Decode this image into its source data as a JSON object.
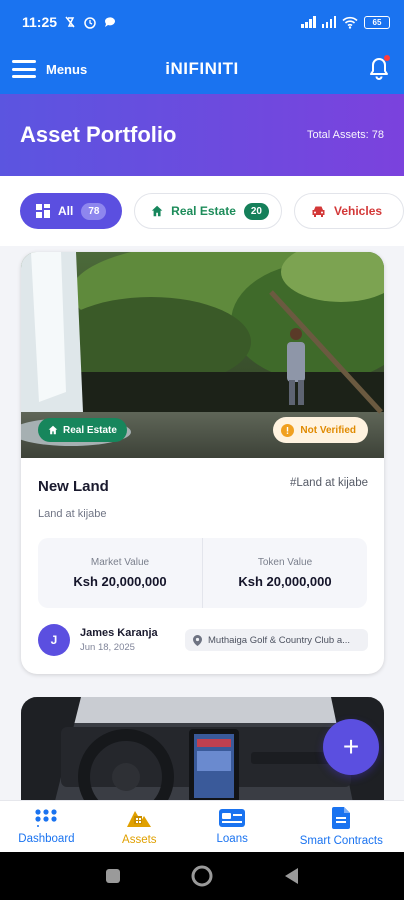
{
  "status_bar": {
    "time": "11:25",
    "battery": "65"
  },
  "app_bar": {
    "menu_label": "Menus",
    "title": "iNIFINITI"
  },
  "header": {
    "title": "Asset Portfolio",
    "total_assets": "Total Assets: 78"
  },
  "filters": [
    {
      "label": "All",
      "count": "78",
      "icon": "grid-icon",
      "selected": true
    },
    {
      "label": "Real Estate",
      "count": "20",
      "icon": "house-icon",
      "color": "#17865c"
    },
    {
      "label": "Vehicles",
      "icon": "car-icon",
      "color": "#d33838"
    }
  ],
  "asset_card": {
    "category": "Real Estate",
    "verification": "Not Verified",
    "title": "New Land",
    "code": "#Land at kijabe",
    "description": "Land at kijabe",
    "market_value_label": "Market Value",
    "market_value": "Ksh 20,000,000",
    "token_value_label": "Token Value",
    "token_value": "Ksh 20,000,000",
    "owner_initial": "J",
    "owner_name": "James Karanja",
    "date": "Jun 18, 2025",
    "location": "Muthaiga Golf & Country Club a..."
  },
  "fab": {
    "label": "+"
  },
  "bottom_nav": [
    {
      "label": "Dashboard",
      "icon": "dashboard-icon"
    },
    {
      "label": "Assets",
      "icon": "assets-icon",
      "active": true
    },
    {
      "label": "Loans",
      "icon": "loans-icon"
    },
    {
      "label": "Smart Contracts",
      "icon": "document-icon"
    }
  ],
  "colors": {
    "primary": "#1a73f0",
    "accent": "#5b4fe0",
    "success": "#17865c",
    "warning": "#e08a00",
    "danger": "#d33838"
  }
}
